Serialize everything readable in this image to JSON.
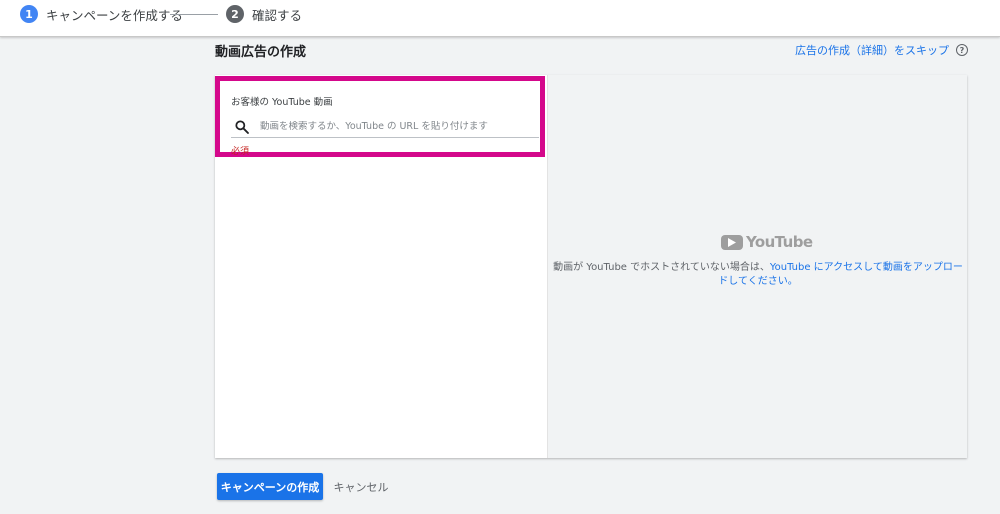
{
  "colors": {
    "accent": "#1a73e8",
    "step_active": "#4285f4",
    "step_inactive": "#5f6368",
    "highlight_border": "#d4088b",
    "required": "#c5221f"
  },
  "stepper": {
    "steps": [
      {
        "number": "1",
        "label": "キャンペーンを作成する",
        "state": "active"
      },
      {
        "number": "2",
        "label": "確認する",
        "state": "inactive"
      }
    ]
  },
  "header": {
    "title": "動画広告の作成",
    "skip_link": "広告の作成（詳細）をスキップ",
    "help_icon": "help-circle-icon",
    "help_glyph": "?"
  },
  "video_picker": {
    "label": "お客様の YouTube 動画",
    "search_icon": "search-icon",
    "search_placeholder": "動画を検索するか、YouTube の URL を貼り付けます",
    "search_value": "",
    "required_text": "必須"
  },
  "preview": {
    "logo_icon": "youtube-logo-icon",
    "logo_text": "YouTube",
    "message_prefix": "動画が YouTube でホストされていない場合は、",
    "message_link": "YouTube にアクセスして動画をアップロードしてください。"
  },
  "actions": {
    "create_label": "キャンペーンの作成",
    "cancel_label": "キャンセル"
  }
}
